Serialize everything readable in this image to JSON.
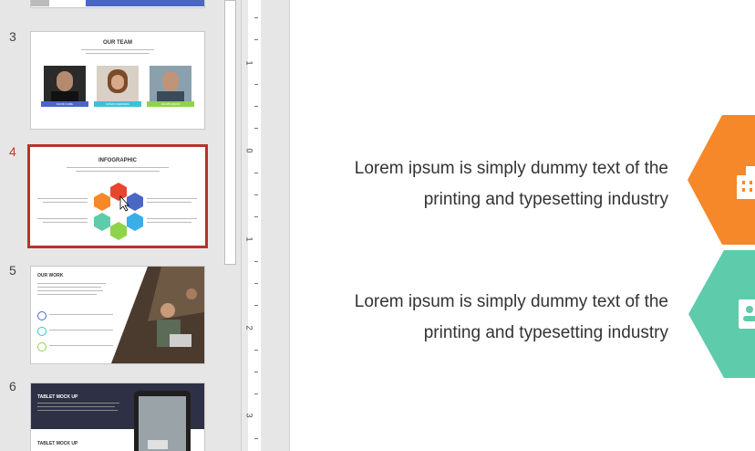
{
  "panel": {
    "slides": [
      {
        "number": "3",
        "title": "OUR TEAM",
        "members": [
          "DAVID CABE",
          "SUSAN FERRERA",
          "JACOB ADAMS"
        ]
      },
      {
        "number": "4",
        "title": "INFOGRAPHIC",
        "selected": true
      },
      {
        "number": "5",
        "title": "OUR WORK"
      },
      {
        "number": "6",
        "title": "TABLET MOCK UP",
        "subtitle": "TABLET MOCK UP"
      }
    ]
  },
  "ruler": {
    "labels": [
      "1",
      "0",
      "1",
      "2",
      "3"
    ]
  },
  "canvas": {
    "text_1": "Lorem ipsum is simply dummy text of the printing and typesetting industry",
    "text_2": "Lorem ipsum is simply dummy text of the printing and typesetting industry",
    "icons": [
      "building-icon",
      "contact-card-icon"
    ]
  },
  "colors": {
    "accent_red": "#b5342a",
    "orange": "#f6882a",
    "teal": "#5ecbaa",
    "blue": "#4a67c6"
  }
}
